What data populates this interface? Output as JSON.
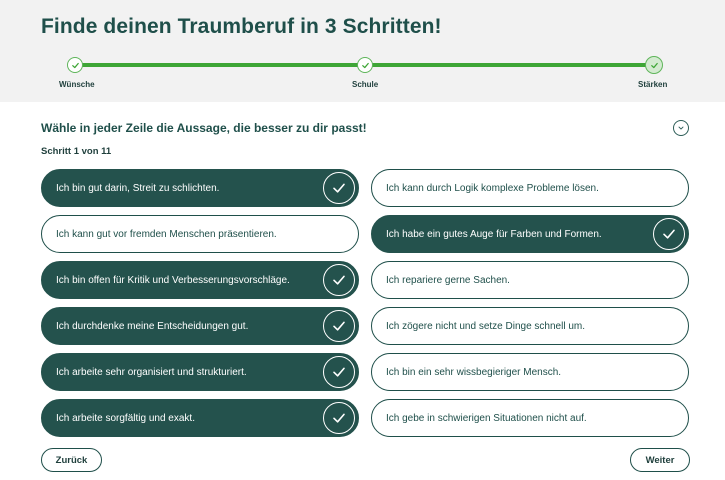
{
  "header": {
    "title": "Finde deinen Traumberuf in 3 Schritten!",
    "steps": [
      {
        "label": "Wünsche",
        "done": true
      },
      {
        "label": "Schule",
        "done": true
      },
      {
        "label": "Stärken",
        "done": true
      }
    ],
    "progress": 1.0
  },
  "question": {
    "title": "Wähle in jeder Zeile die Aussage, die besser zu dir passt!",
    "step_info": "Schritt 1 von 11"
  },
  "rows": [
    {
      "left": "Ich bin gut darin, Streit zu schlichten.",
      "right": "Ich kann durch Logik komplexe Probleme lösen.",
      "selected": "left"
    },
    {
      "left": "Ich kann gut vor fremden Menschen präsentieren.",
      "right": "Ich habe ein gutes Auge für Farben und Formen.",
      "selected": "right"
    },
    {
      "left": "Ich bin offen für Kritik und Verbesserungsvorschläge.",
      "right": "Ich repariere gerne Sachen.",
      "selected": "left"
    },
    {
      "left": "Ich durchdenke meine Entscheidungen gut.",
      "right": "Ich zögere nicht und setze Dinge schnell um.",
      "selected": "left"
    },
    {
      "left": "Ich arbeite sehr organisiert und strukturiert.",
      "right": "Ich bin ein sehr wissbegieriger Mensch.",
      "selected": "left"
    },
    {
      "left": "Ich arbeite sorgfältig und exakt.",
      "right": "Ich gebe in schwierigen Situationen nicht auf.",
      "selected": "left"
    }
  ],
  "footer": {
    "back_label": "Zurück",
    "next_label": "Weiter"
  },
  "colors": {
    "brand_dark": "#24524d",
    "progress_green": "#3ea636",
    "header_bg": "#f2f2f2"
  },
  "icons": {
    "check": "check-icon",
    "collapse": "chevron-down-icon"
  }
}
